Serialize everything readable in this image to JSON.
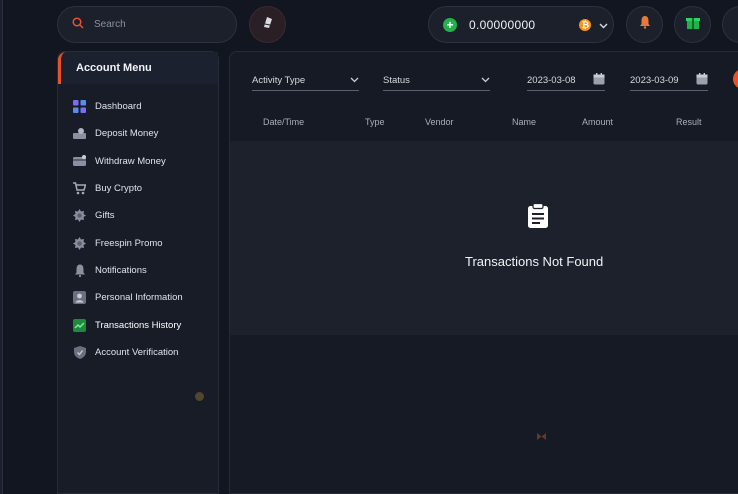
{
  "search": {
    "placeholder": "Search"
  },
  "wallet": {
    "balance": "0.00000000",
    "currency_icon": "bitcoin-icon"
  },
  "sidebar": {
    "title": "Account Menu",
    "items": [
      {
        "label": "Dashboard",
        "icon": "dashboard-icon"
      },
      {
        "label": "Deposit Money",
        "icon": "deposit-icon"
      },
      {
        "label": "Withdraw Money",
        "icon": "withdraw-icon"
      },
      {
        "label": "Buy Crypto",
        "icon": "cart-icon"
      },
      {
        "label": "Gifts",
        "icon": "gift-icon"
      },
      {
        "label": "Freespin Promo",
        "icon": "promo-icon"
      },
      {
        "label": "Notifications",
        "icon": "bell-icon"
      },
      {
        "label": "Personal Information",
        "icon": "user-icon"
      },
      {
        "label": "Transactions History",
        "icon": "transactions-icon"
      },
      {
        "label": "Account Verification",
        "icon": "shield-icon"
      }
    ],
    "active": "Transactions History"
  },
  "filters": {
    "activity_type": "Activity Type",
    "status": "Status",
    "date_from": "2023-03-08",
    "date_to": "2023-03-09"
  },
  "table": {
    "columns": [
      "Date/Time",
      "Type",
      "Vendor",
      "Name",
      "Amount",
      "Result"
    ],
    "empty_message": "Transactions Not Found"
  },
  "colors": {
    "accent": "#e8522a",
    "active_green": "#22b14c",
    "bitcoin": "#f7931a"
  }
}
